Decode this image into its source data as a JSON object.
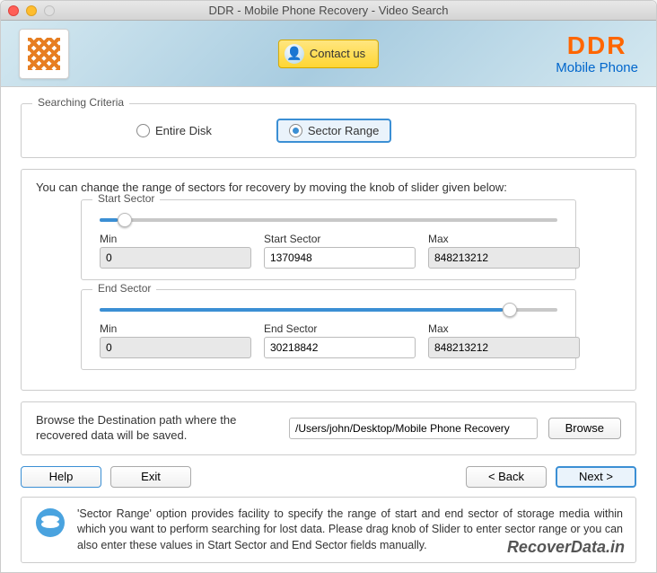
{
  "window": {
    "title": "DDR - Mobile Phone Recovery - Video Search"
  },
  "header": {
    "contact_label": "Contact us",
    "brand_title": "DDR",
    "brand_subtitle": "Mobile Phone"
  },
  "criteria": {
    "legend": "Searching Criteria",
    "option_entire": "Entire Disk",
    "option_sector": "Sector Range",
    "selected": "sector"
  },
  "range": {
    "desc": "You can change the range of sectors for recovery by moving the knob of slider given below:",
    "start": {
      "legend": "Start Sector",
      "min_label": "Min",
      "min": "0",
      "val_label": "Start Sector",
      "val": "1370948",
      "max_label": "Max",
      "max": "848213212",
      "slider_pct": 4
    },
    "end": {
      "legend": "End Sector",
      "min_label": "Min",
      "min": "0",
      "val_label": "End Sector",
      "val": "30218842",
      "max_label": "Max",
      "max": "848213212",
      "slider_pct": 88
    }
  },
  "browse": {
    "label": "Browse the Destination path where the recovered data will be saved.",
    "path": "/Users/john/Desktop/Mobile Phone Recovery",
    "button": "Browse"
  },
  "nav": {
    "help": "Help",
    "exit": "Exit",
    "back": "< Back",
    "next": "Next >"
  },
  "info": {
    "text": "'Sector Range' option provides facility to specify the range of start and end sector of storage media within which you want to perform searching for lost data. Please drag knob of Slider to enter sector range or you can also enter these values in Start Sector and End Sector fields manually."
  },
  "watermark": "RecoverData.in"
}
